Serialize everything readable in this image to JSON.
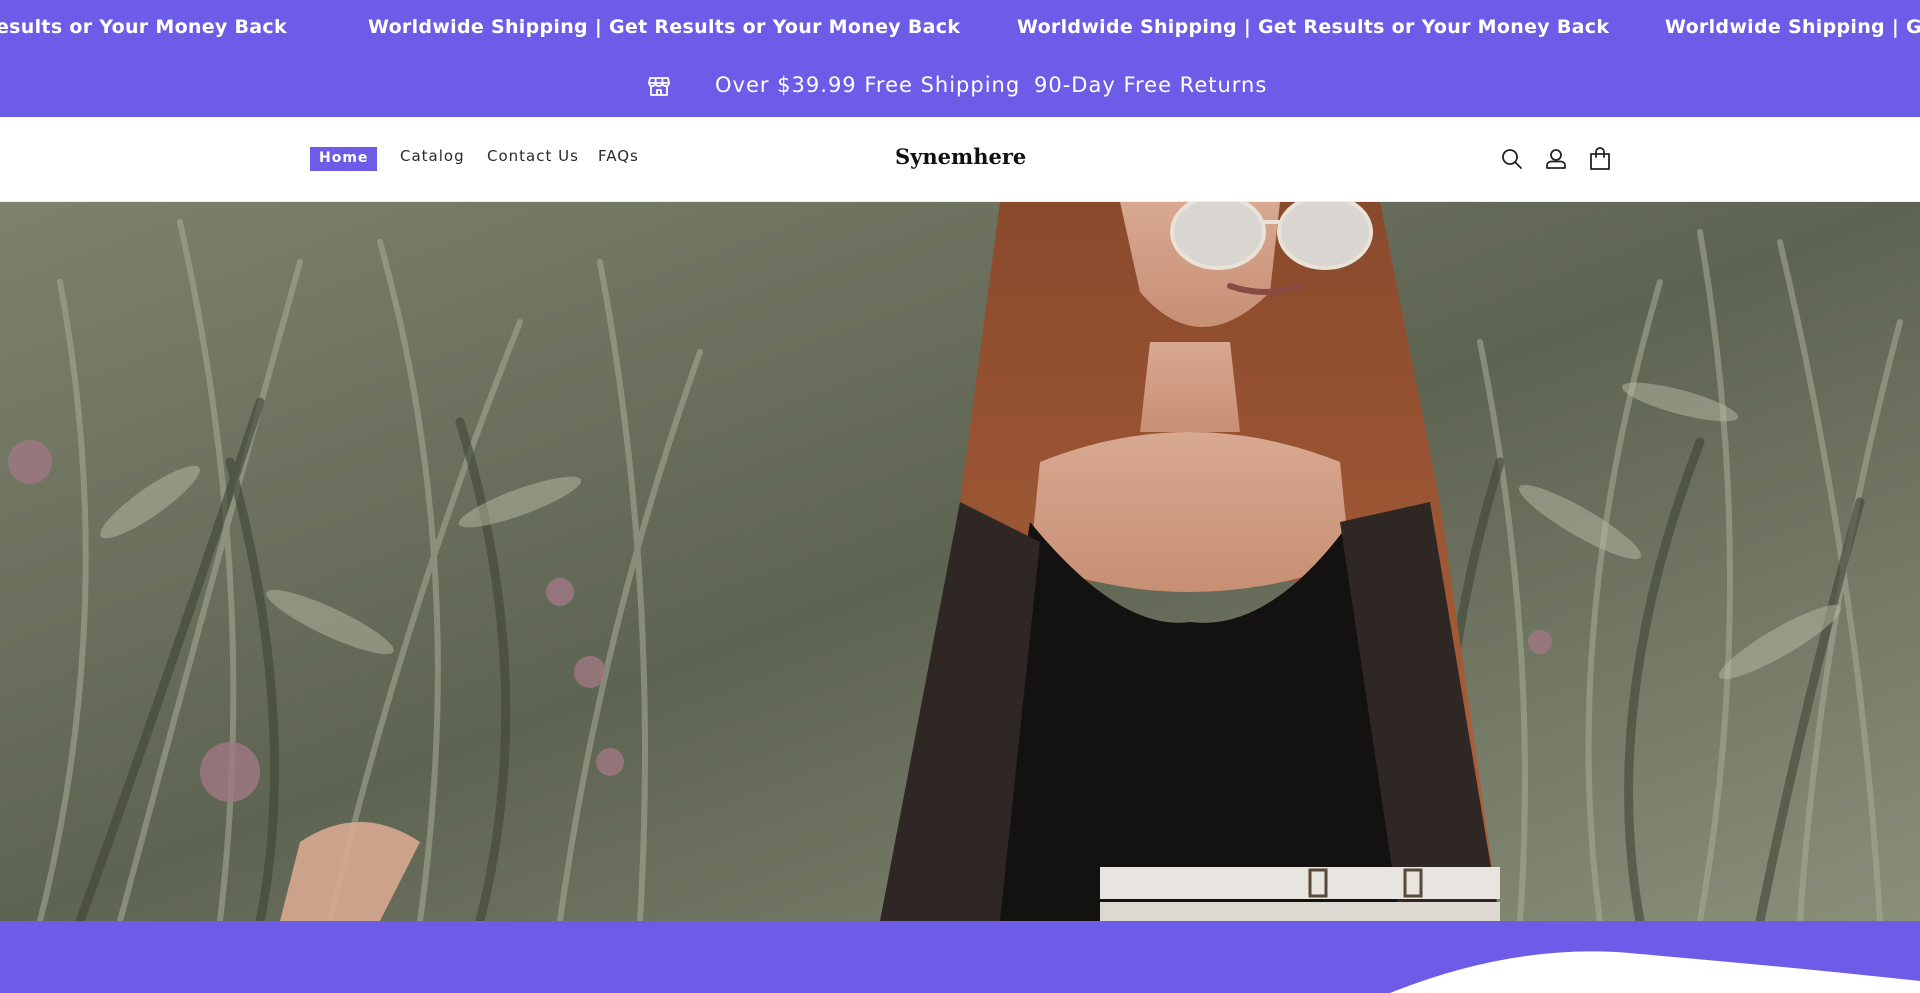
{
  "marquee": {
    "items": [
      "esults or Your Money Back",
      "Worldwide Shipping | Get Results or Your Money Back",
      "Worldwide Shipping | Get Results or Your Money Back",
      "Worldwide Shipping | Get"
    ]
  },
  "announcement": {
    "icon": "store-icon",
    "free_shipping": "Over $39.99 Free Shipping",
    "returns": "90-Day Free Returns"
  },
  "header": {
    "nav": {
      "home": "Home",
      "catalog": "Catalog",
      "contact": "Contact Us",
      "faqs": "FAQs"
    },
    "logo": "Synemhere",
    "icons": [
      "search-icon",
      "account-icon",
      "cart-icon"
    ]
  },
  "colors": {
    "accent": "#6c5ce7",
    "background": "#ffffff",
    "text": "#121212"
  }
}
